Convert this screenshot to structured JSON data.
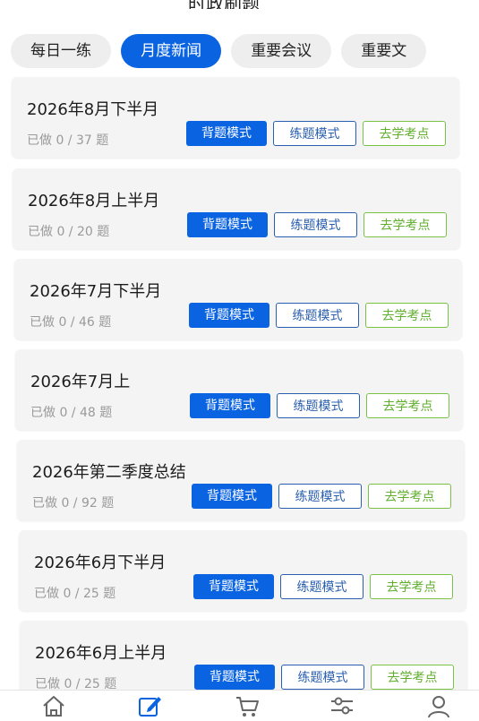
{
  "header": {
    "title": "时政刷题"
  },
  "tabs": [
    {
      "label": "每日一练",
      "active": false
    },
    {
      "label": "月度新闻",
      "active": true
    },
    {
      "label": "重要会议",
      "active": false
    },
    {
      "label": "重要文",
      "active": false
    }
  ],
  "buttons": {
    "recite": "背题模式",
    "practice": "练题模式",
    "points": "去学考点"
  },
  "sets": [
    {
      "title": "2026年8月下半月",
      "progress": "已做 0 / 37 题"
    },
    {
      "title": "2026年8月上半月",
      "progress": "已做 0 / 20 题"
    },
    {
      "title": "2026年7月下半月",
      "progress": "已做 0 / 46 题"
    },
    {
      "title": "2026年7月上",
      "progress": "已做 0 / 48 题"
    },
    {
      "title": "2026年第二季度总结",
      "progress": "已做 0 / 92 题"
    },
    {
      "title": "2026年6月下半月",
      "progress": "已做 0 / 25 题"
    },
    {
      "title": "2026年6月上半月",
      "progress": "已做 0 / 25 题"
    }
  ],
  "bottom_nav": [
    {
      "icon": "home-icon",
      "active": false
    },
    {
      "icon": "edit-icon",
      "active": true
    },
    {
      "icon": "cart-icon",
      "active": false
    },
    {
      "icon": "sliders-icon",
      "active": false
    },
    {
      "icon": "user-icon",
      "active": false
    }
  ],
  "colors": {
    "accent": "#0a63e0",
    "green": "#78c246",
    "practice_border": "#2a5fb0"
  }
}
